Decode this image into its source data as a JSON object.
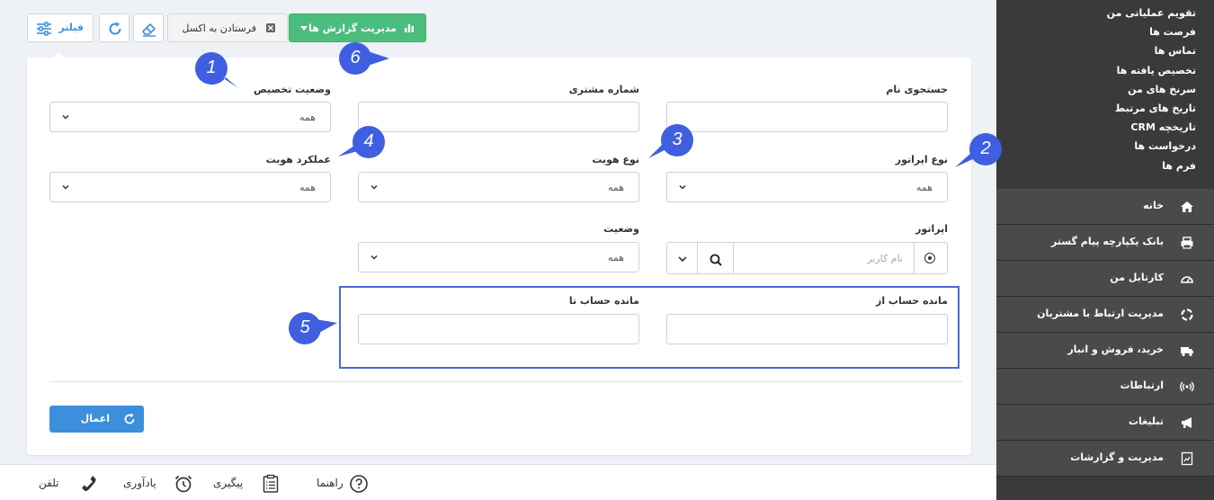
{
  "sidebar": {
    "submenu": [
      "تقویم عملیاتی من",
      "فرصت ها",
      "تماس ها",
      "تخصیص یافته ها",
      "سرنخ های من",
      "تاریخ های مرتبط",
      "تاریخچه CRM",
      "درخواست ها",
      "فرم ها"
    ],
    "menu": [
      {
        "label": "خانه",
        "icon": "home-icon"
      },
      {
        "label": "بانک یکپارچه پیام گستر",
        "icon": "printer-icon"
      },
      {
        "label": "کارتابل من",
        "icon": "dashboard-icon"
      },
      {
        "label": "مدیریت ارتباط با مشتریان",
        "icon": "crm-cycle-icon"
      },
      {
        "label": "خرید، فروش و انبار",
        "icon": "truck-icon"
      },
      {
        "label": "ارتباطات",
        "icon": "broadcast-icon"
      },
      {
        "label": "تبلیغات",
        "icon": "megaphone-icon"
      },
      {
        "label": "مدیریت و گزارشات",
        "icon": "report-icon"
      }
    ]
  },
  "toolbar": {
    "filter_label": "فیلتر",
    "excel_label": "فرستادن به اکسل",
    "report_label": "مدیریت گزارش ها"
  },
  "filters": {
    "assign_status": {
      "label": "وضعیت تخصیص",
      "value": "همه"
    },
    "customer_number": {
      "label": "شماره مشتری",
      "value": ""
    },
    "name_search": {
      "label": "جستجوی نام",
      "value": ""
    },
    "identity_function": {
      "label": "عملکرد هویت",
      "value": "همه"
    },
    "identity_type": {
      "label": "نوع هویت",
      "value": "همه"
    },
    "operator_type": {
      "label": "نوع اپراتور",
      "value": "همه"
    },
    "status": {
      "label": "وضعیت",
      "value": "همه"
    },
    "operator": {
      "label": "اپراتور",
      "placeholder": "نام کاربر"
    },
    "balance_to": {
      "label": "مانده حساب تا",
      "value": ""
    },
    "balance_from": {
      "label": "مانده حساب از",
      "value": ""
    }
  },
  "apply_label": "اعمال",
  "callouts": [
    "1",
    "2",
    "3",
    "4",
    "5",
    "6"
  ],
  "colors": {
    "accent_blue": "#3d8fdb",
    "report_green": "#4bbd7c",
    "callout_blue": "#3f5fe0",
    "sidebar_dark": "#3a3a3a"
  },
  "bottom_bar": {
    "guide": "راهنما",
    "followup": "پیگیری",
    "reminder": "یادآوری",
    "phone": "تلفن"
  }
}
